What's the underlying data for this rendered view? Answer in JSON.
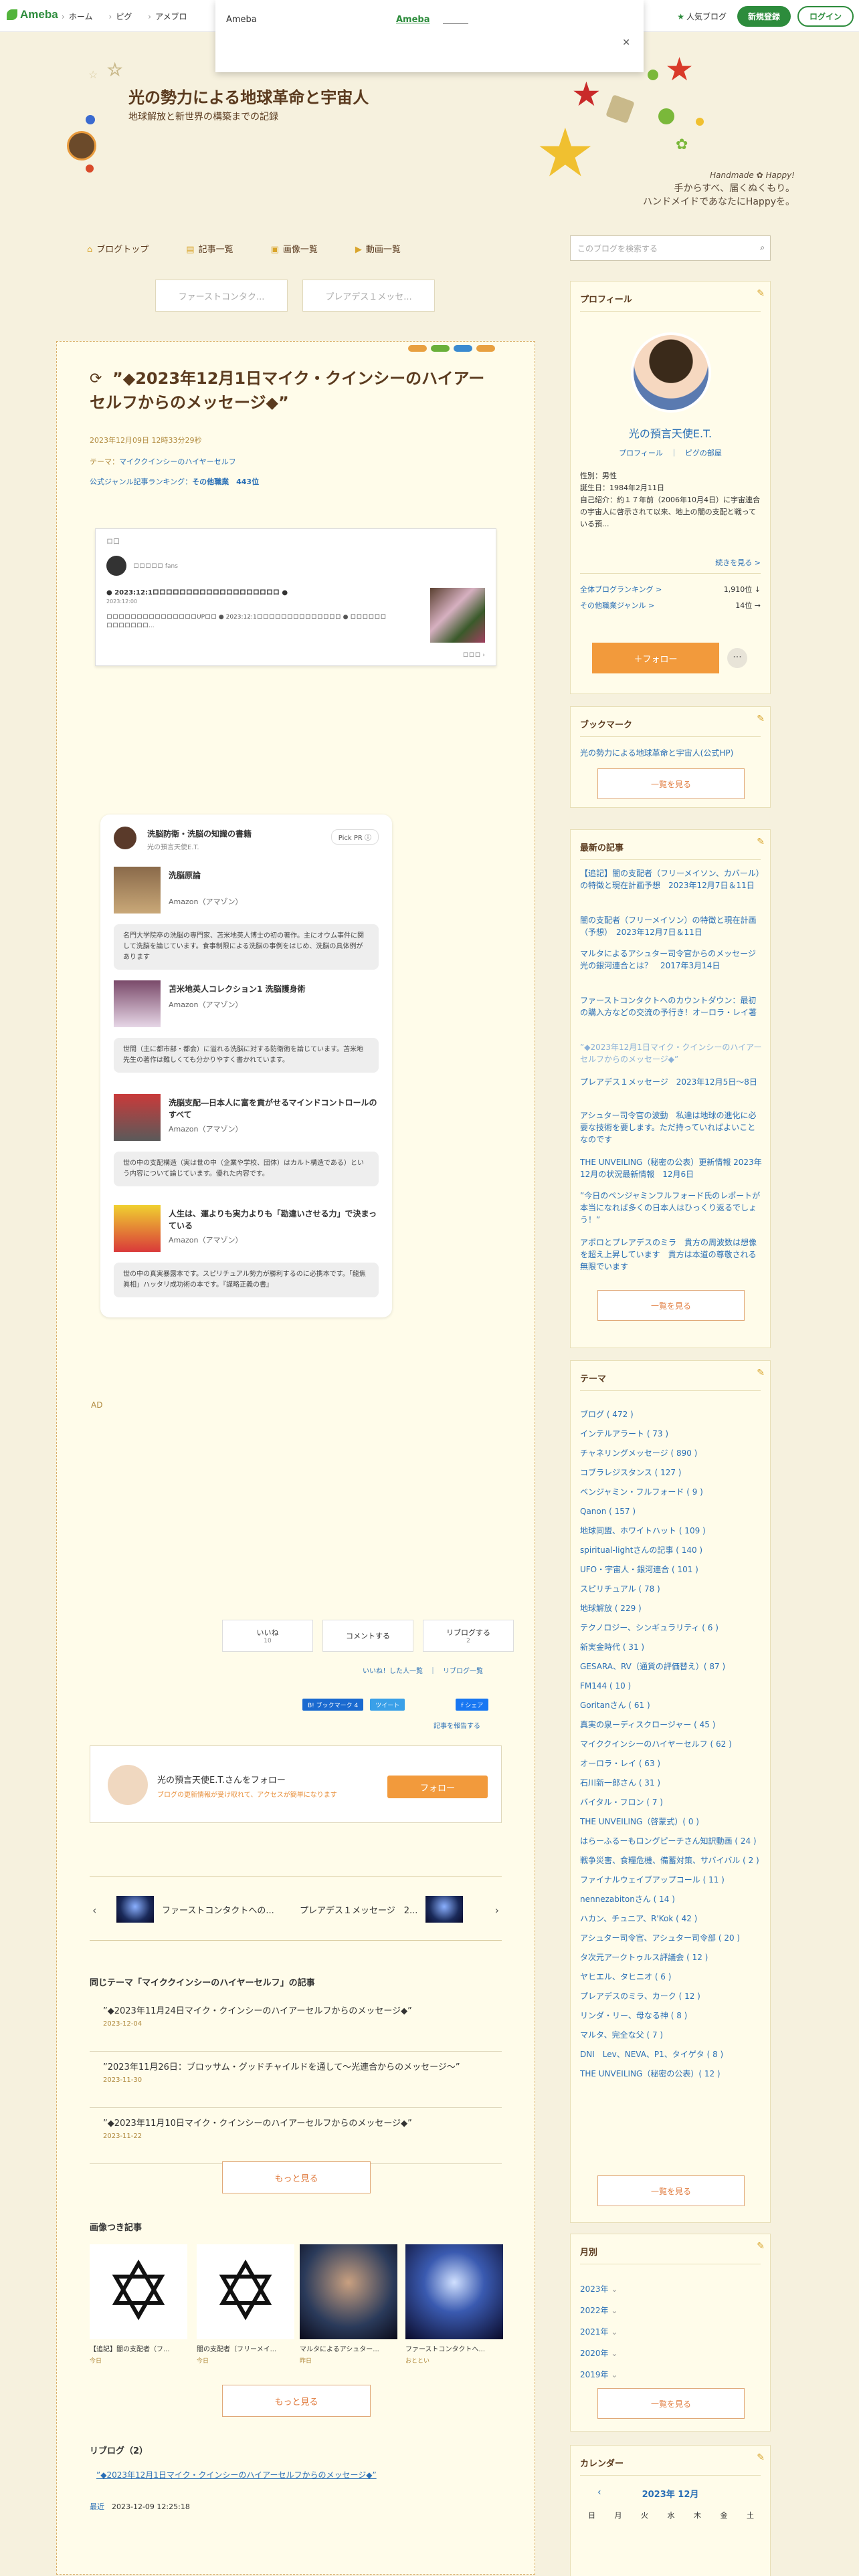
{
  "topbar": {
    "logo": "Ameba",
    "nav": [
      "ホーム",
      "ピグ",
      "アメブロ"
    ],
    "popular": "人気ブログ",
    "register": "新規登録",
    "login": "ログイン"
  },
  "popup": {
    "label1": "Ameba",
    "label2": "Ameba",
    "close": "✕"
  },
  "header": {
    "title": "光の勢力による地球革命と宇宙人",
    "desc": "地球解放と新世界の構築までの記録",
    "handmade_en": "Handmade ✿ Happy!",
    "handmade_1": "手からすべ、届くぬくもり。",
    "handmade_2": "ハンドメイドであなたにHappyを。"
  },
  "menu": [
    "ブログトップ",
    "記事一覧",
    "画像一覧",
    "動画一覧"
  ],
  "search": {
    "placeholder": "このブログを検索する"
  },
  "pager": {
    "prev": "ファーストコンタク...",
    "next": "プレアデス１メッセ..."
  },
  "article": {
    "title": "”◆2023年12月1日マイク・クインシーのハイアーセルフからのメッセージ◆”",
    "date": "2023年12月09日 12時33分29秒",
    "theme_label": "テーマ：",
    "theme": "マイククインシーのハイヤーセルフ",
    "rank_label": "公式ジャンル記事ランキング：",
    "rank": "その他職業　443位",
    "embed": {
      "head": "ロ口",
      "user": "ロロロロロ fans",
      "title": "● 2023:12:1ロロロロロロロロロロロロロロロロロロロ ●",
      "date": "2023:12:00",
      "body": "ロロロロロロロロロロロロロロロUPロロ ● 2023:12:1ロロロロロロロロロロロロロロ ● ロロロロロロロロロロロロロ...",
      "more": "ロロロ ›"
    },
    "pick": {
      "title": "洗脳防衛・洗脳の知識の書籍",
      "sub": "光の預言天使E.T.",
      "badge": "Pick PR ⓘ",
      "items": [
        {
          "name": "洗脳原論",
          "src": "Amazon（アマゾン）",
          "desc": "名門大学院卒の洗脳の専門家、苫米地英人博士の初の著作。主にオウム事件に関して洗脳を論じています。食事制限による洗脳の事例をはじめ、洗脳の具体例があります"
        },
        {
          "name": "苫米地英人コレクション1 洗脳護身術",
          "src": "Amazon（アマゾン）",
          "desc": "世間（主に都市部・都会）に溢れる洗脳に対する防衛術を論じています。苫米地先生の著作は難しくても分かりやすく書かれています。"
        },
        {
          "name": "洗脳支配―日本人に富を貢がせるマインドコントロールのすべて",
          "src": "Amazon（アマゾン）",
          "desc": "世の中の支配構造（実は世の中（企業や学校、団体）はカルト構造である）という内容について論じています。優れた内容です。"
        },
        {
          "name": "人生は、運よりも実力よりも「勘違いさせる力」で決まっている",
          "src": "Amazon（アマゾン）",
          "desc": "世の中の真実暴露本です。スピリチュアル勢力が勝利するのに必携本です。「龍焦眞相」ハッタリ成功術の本です。『謀略正義の書』"
        }
      ]
    },
    "ad": "AD",
    "like": "いいね",
    "like_count": "10",
    "comment": "コメントする",
    "reblog": "リブログする",
    "reblog_count": "2",
    "like_links": "いいね！した人一覧　｜　リブログ一覧",
    "share": [
      "B! ブックマーク 4",
      "ツイート",
      "f シェア"
    ],
    "report": "記事を報告する",
    "follow": {
      "title": "光の預言天使E.T.さんをフォロー",
      "sub": "ブログの更新情報が受け取れて、アクセスが簡単になります",
      "btn": "フォロー"
    },
    "nav": {
      "prev": "ファーストコンタクトへの...",
      "next": "プレアデス１メッセージ　2..."
    },
    "same_theme_h": "同じテーマ「マイククインシーのハイヤーセルフ」の記事",
    "same_theme": [
      {
        "t": "”◆2023年11月24日マイク・クインシーのハイアーセルフからのメッセージ◆”",
        "d": "2023-12-04"
      },
      {
        "t": "”2023年11月26日：ブロッサム・グッドチャイルドを通して〜光連合からのメッセージ〜”",
        "d": "2023-11-30"
      },
      {
        "t": "”◆2023年11月10日マイク・クインシーのハイアーセルフからのメッセージ◆”",
        "d": "2023-11-22"
      }
    ],
    "more": "もっと見る",
    "img_h": "画像つき記事",
    "images": [
      {
        "cap": "【追記】闇の支配者（フ...",
        "dt": "今日"
      },
      {
        "cap": "闇の支配者（フリーメイ...",
        "dt": "今日"
      },
      {
        "cap": "マルタによるアシュター...",
        "dt": "昨日"
      },
      {
        "cap": "ファーストコンタクトへ...",
        "dt": "おととい"
      }
    ],
    "reblog_h": "リブログ（2）",
    "reblog_item": "”◆2023年12月1日マイク・クインシーのハイアーセルフからのメッセージ◆”",
    "reblog_date_l": "最近",
    "reblog_date": "2023-12-09 12:25:18"
  },
  "sidebar": {
    "profile_h": "プロフィール",
    "name": "光の預言天使E.T.",
    "profile_link": "プロフィール　｜　ピグの部屋",
    "info": [
      "性別：男性",
      "誕生日：1984年2月11日",
      "自己紹介：約１７年前（2006年10月4日）に宇宙連合の宇宙人に啓示されて以来、地上の闇の支配と戦っている預..."
    ],
    "more": "続きを見る >",
    "rank1_l": "全体ブログランキング >",
    "rank1_v": "1,910位 ↓",
    "rank2_l": "その他職業ジャンル >",
    "rank2_v": "14位 →",
    "follow": "＋フォロー",
    "bookmark_h": "ブックマーク",
    "bookmark": "光の勢力による地球革命と宇宙人(公式HP)",
    "list_btn": "一覧を見る",
    "recent_h": "最新の記事",
    "recent": [
      "【追記】闇の支配者（フリーメイソン、カバール）の特徴と現在計画予想　2023年12月7日＆11日",
      "闇の支配者（フリーメイソン）の特徴と現在計画（予想）　2023年12月7日＆11日",
      "マルタによるアシュター司令官からのメッセージ　光の銀河連合とは？　2017年3月14日",
      "ファーストコンタクトへのカウントダウン：最初の購入方などの交流の予行き！オーロラ・レイ著",
      "”◆2023年12月1日マイク・クインシーのハイアーセルフからのメッセージ◆”",
      "プレアデス１メッセージ　2023年12月5日〜8日",
      "アシュター司令官の波動　私達は地球の進化に必要な技術を要します。ただ持っていればよいことなのです",
      "THE UNVEILING（秘密の公表）更新情報 2023年12月の状況最新情報　12月6日",
      "”今日のペンジャミンフルフォード氏のレポートが本当になれば多くの日本人はひっくり返るでしょう！”",
      "アポロとプレアデスのミラ　貴方の周波数は想像を超え上昇しています　貴方は本道の尊敬される無限でいます"
    ],
    "theme_h": "テーマ",
    "themes": [
      "ブログ ( 472 )",
      "インテルアラート ( 73 )",
      "チャネリングメッセージ ( 890 )",
      "コブラレジスタンス ( 127 )",
      "ベンジャミン・フルフォード ( 9 )",
      "Qanon ( 157 )",
      "地球同盟、ホワイトハット ( 109 )",
      "spiritual-lightさんの記事 ( 140 )",
      "UFO・宇宙人・銀河連合 ( 101 )",
      "スピリチュアル ( 78 )",
      "地球解放 ( 229 )",
      "テクノロジー、シンギュラリティ ( 6 )",
      "新実金時代 ( 31 )",
      "GESARA、RV（通貨の評価替え）( 87 )",
      "FM144 ( 10 )",
      "Goritanさん ( 61 )",
      "真実の泉ーディスクロージャー ( 45 )",
      "マイククインシーのハイヤーセルフ ( 62 )",
      "オーロラ・レイ ( 63 )",
      "石川新一郎さん ( 31 )",
      "バイタル・フロン ( 7 )",
      "THE UNVEILING（啓蒙式）( 0 )",
      "はらーふるーもロングピーチさん知訳動画 ( 24 )",
      "戦争災害、食糧危機、備蓄対策、サバイバル ( 2 )",
      "ファイナルウェイブアップコール ( 11 )",
      "nennezabitonさん ( 14 )",
      "ハカン、チュニア、R'Kok ( 42 )",
      "アシュター司令官、アシュター司令部 ( 20 )",
      "タ次元アークトゥルス評議会 ( 12 )",
      "ヤヒエル、タヒニオ ( 6 )",
      "プレアデスのミラ、カーク ( 12 )",
      "リンダ・リー、母なる神 ( 8 )",
      "マルタ、完全な父 ( 7 )",
      "DNI　Lev、NEVA、P1、タイゲタ ( 8 )",
      "THE UNVEILING（秘密の公表）( 12 )"
    ],
    "month_h": "月別",
    "months": [
      "2023年",
      "2022年",
      "2021年",
      "2020年",
      "2019年"
    ],
    "cal_h": "カレンダー",
    "cal_month": "2023年 12月",
    "cal_days": [
      "日",
      "月",
      "火",
      "水",
      "木",
      "金",
      "土"
    ]
  }
}
